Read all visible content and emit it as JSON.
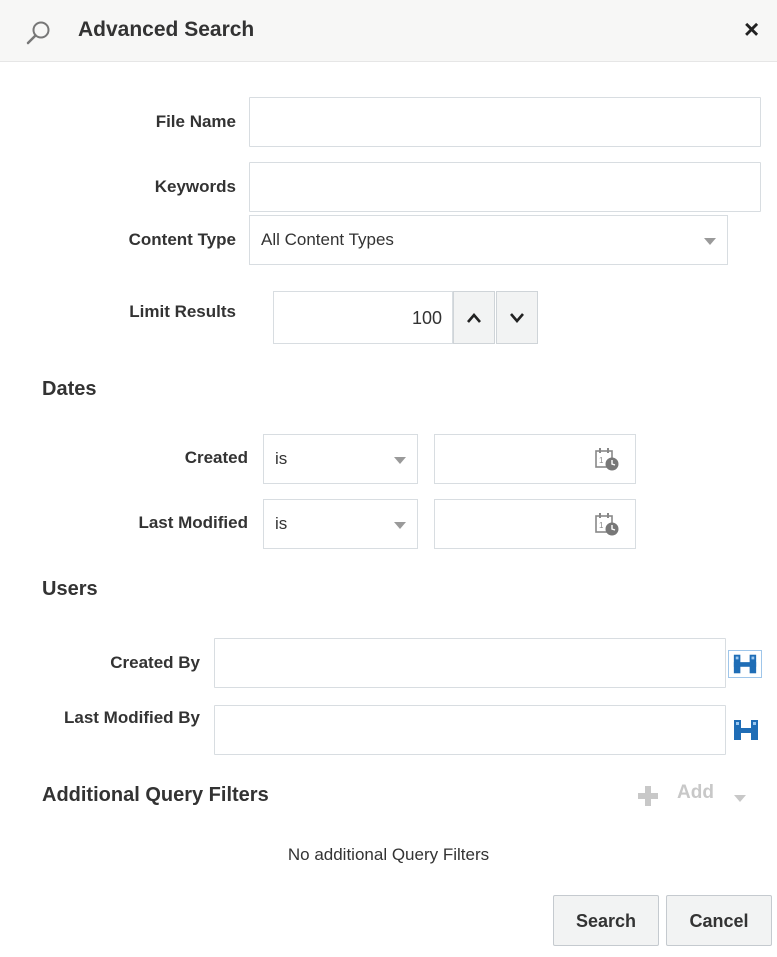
{
  "dialog": {
    "title": "Advanced Search",
    "close_label": "×",
    "search_icon": "search-icon"
  },
  "fields": {
    "file_name": {
      "label": "File Name",
      "value": ""
    },
    "keywords": {
      "label": "Keywords",
      "value": ""
    },
    "content_type": {
      "label": "Content Type",
      "selected": "All Content Types"
    },
    "limit_results": {
      "label": "Limit Results",
      "value": "100"
    }
  },
  "dates": {
    "heading": "Dates",
    "created": {
      "label": "Created",
      "operator": "is",
      "value": ""
    },
    "last_modified": {
      "label": "Last Modified",
      "operator": "is",
      "value": ""
    }
  },
  "users": {
    "heading": "Users",
    "created_by": {
      "label": "Created By",
      "value": ""
    },
    "last_modified_by": {
      "label": "Last Modified By",
      "value": ""
    }
  },
  "filters": {
    "heading": "Additional Query Filters",
    "add_label": "Add",
    "empty_message": "No additional Query Filters"
  },
  "buttons": {
    "search": "Search",
    "cancel": "Cancel"
  },
  "colors": {
    "header_bg": "#f7f7f6",
    "user_icon": "#1f6db6",
    "disabled": "#c8c8c8"
  }
}
